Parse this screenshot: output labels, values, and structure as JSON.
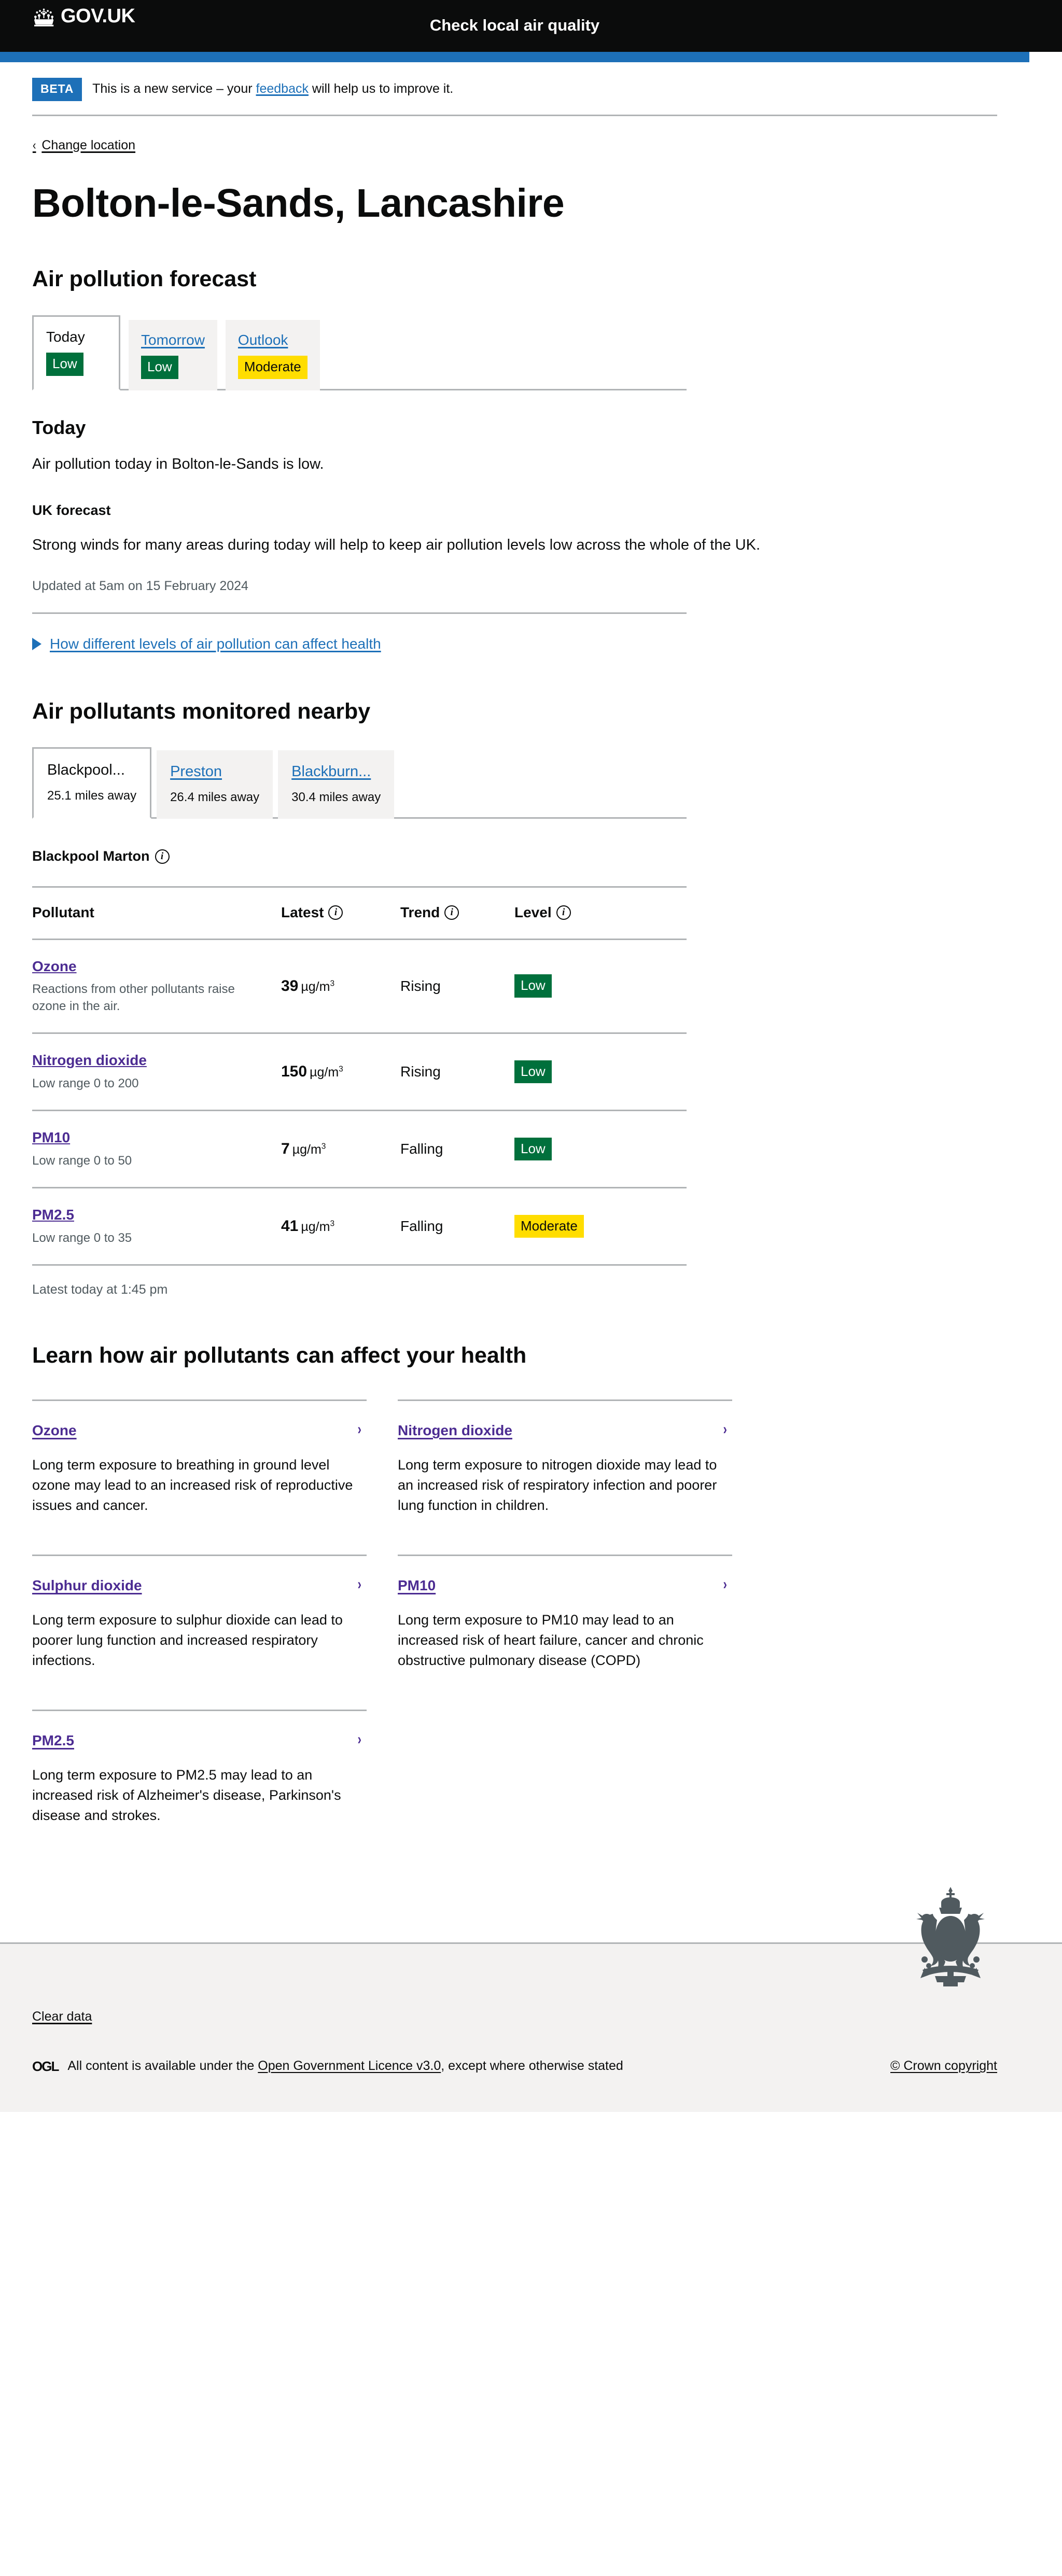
{
  "header": {
    "brand": "GOV.UK",
    "service_name": "Check local air quality"
  },
  "phase_banner": {
    "tag": "BETA",
    "text_before": "This is a new service – your ",
    "link": "feedback",
    "text_after": " will help us to improve it."
  },
  "back_link": {
    "label": "Change location",
    "chevron": "‹"
  },
  "page_title": "Bolton-le-Sands, Lancashire",
  "forecast": {
    "heading": "Air pollution forecast",
    "tabs": [
      {
        "label": "Today",
        "badge": "Low",
        "level": "low"
      },
      {
        "label": "Tomorrow",
        "badge": "Low",
        "level": "low"
      },
      {
        "label": "Outlook",
        "badge": "Moderate",
        "level": "moderate"
      }
    ],
    "panel": {
      "heading": "Today",
      "summary": "Air pollution today in Bolton-le-Sands is low.",
      "uk_forecast_heading": "UK forecast",
      "uk_forecast_text": "Strong winds for many areas during today will help to keep air pollution levels low across the whole of the UK.",
      "updated": "Updated at 5am on 15 February 2024"
    },
    "details_label": "How different levels of air pollution can affect health"
  },
  "pollutants": {
    "heading": "Air pollutants monitored nearby",
    "station_tabs": [
      {
        "name": "Blackpool...",
        "distance": "25.1 miles away"
      },
      {
        "name": "Preston",
        "distance": "26.4 miles away"
      },
      {
        "name": "Blackburn...",
        "distance": "30.4 miles away"
      }
    ],
    "station_heading": "Blackpool Marton",
    "columns": [
      "Pollutant",
      "Latest",
      "Trend",
      "Level"
    ],
    "rows": [
      {
        "name": "Ozone",
        "description": "Reactions from other pollutants raise ozone in the air.",
        "value": "39",
        "unit": "µg/m",
        "unit_sup": "3",
        "trend": "Rising",
        "level": "Low",
        "level_class": "low"
      },
      {
        "name": "Nitrogen dioxide",
        "description": "Low range 0 to 200",
        "value": "150",
        "unit": "µg/m",
        "unit_sup": "3",
        "trend": "Rising",
        "level": "Low",
        "level_class": "low"
      },
      {
        "name": "PM10",
        "description": "Low range 0 to 50",
        "value": "7",
        "unit": "µg/m",
        "unit_sup": "3",
        "trend": "Falling",
        "level": "Low",
        "level_class": "low"
      },
      {
        "name": "PM2.5",
        "description": "Low range 0 to 35",
        "value": "41",
        "unit": "µg/m",
        "unit_sup": "3",
        "trend": "Falling",
        "level": "Moderate",
        "level_class": "moderate"
      }
    ],
    "latest_note": "Latest today at 1:45 pm"
  },
  "health": {
    "heading": "Learn how air pollutants can affect your health",
    "chevron": "›",
    "cards": [
      {
        "title": "Ozone",
        "description": "Long term exposure to breathing in ground level ozone may lead to an increased risk of reproductive issues and cancer."
      },
      {
        "title": "Nitrogen dioxide",
        "description": "Long term exposure to nitrogen dioxide may lead to an increased risk of respiratory infection and poorer lung function in children."
      },
      {
        "title": "Sulphur dioxide",
        "description": "Long term exposure to sulphur dioxide can lead to poorer lung function and increased respiratory infections."
      },
      {
        "title": "PM10",
        "description": "Long term exposure to PM10 may lead to an increased risk of heart failure, cancer and chronic obstructive pulmonary disease (COPD)"
      },
      {
        "title": "PM2.5",
        "description": "Long term exposure to PM2.5 may lead to an increased risk of Alzheimer's disease, Parkinson's disease and strokes."
      }
    ]
  },
  "footer": {
    "clear_data": "Clear data",
    "ogl_logo": "OGL",
    "licence_before": "All content is available under the ",
    "licence_link": "Open Government Licence v3.0",
    "licence_after": ", except where otherwise stated",
    "copyright": "© Crown copyright"
  },
  "colors": {
    "black": "#0b0c0c",
    "blue": "#1d70b8",
    "green": "#00703c",
    "yellow": "#ffdd00",
    "purple": "#4c2c92",
    "grey_text": "#505a5f",
    "grey_bg": "#f3f2f1",
    "grey_border": "#b1b4b6"
  }
}
